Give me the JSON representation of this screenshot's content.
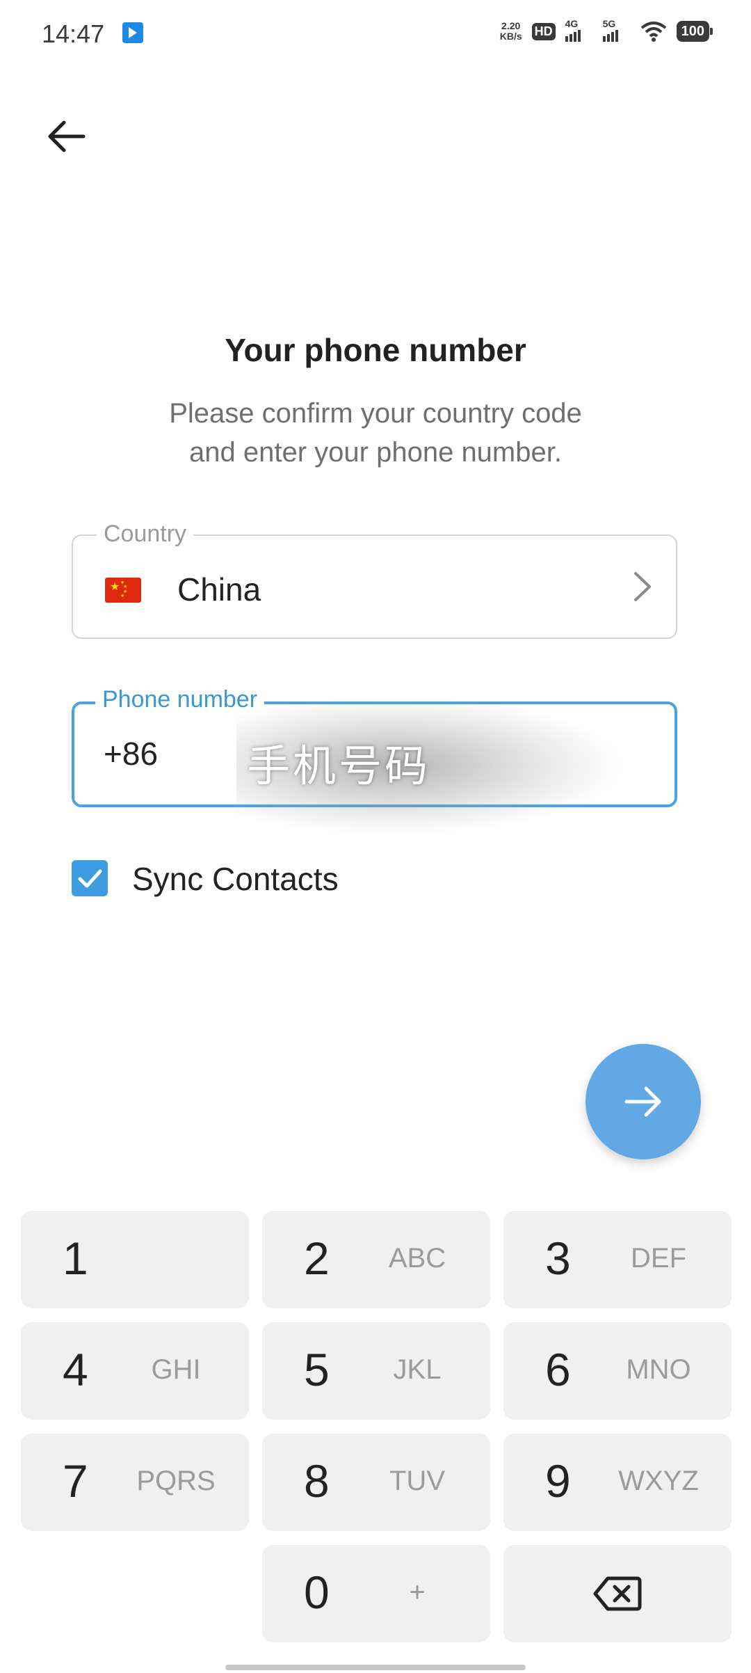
{
  "status_bar": {
    "time": "14:47",
    "net_speed_value": "2.20",
    "net_speed_unit": "KB/s",
    "hd_label": "HD",
    "signal1_label": "4G",
    "signal2_label": "5G",
    "battery": "100"
  },
  "header": {
    "title": "Your phone number",
    "subtitle_line1": "Please confirm your country code",
    "subtitle_line2": "and enter your phone number."
  },
  "country_field": {
    "label": "Country",
    "value": "China",
    "flag_icon": "china-flag-icon"
  },
  "phone_field": {
    "label": "Phone number",
    "prefix": "+86",
    "value": "",
    "redaction_text": "手机号码"
  },
  "sync_contacts": {
    "label": "Sync Contacts",
    "checked": true
  },
  "colors": {
    "accent": "#3d9be0",
    "fab": "#62a8e5",
    "key_bg": "#f0f0f0"
  },
  "keypad": {
    "keys": [
      {
        "num": "1",
        "letters": ""
      },
      {
        "num": "2",
        "letters": "ABC"
      },
      {
        "num": "3",
        "letters": "DEF"
      },
      {
        "num": "4",
        "letters": "GHI"
      },
      {
        "num": "5",
        "letters": "JKL"
      },
      {
        "num": "6",
        "letters": "MNO"
      },
      {
        "num": "7",
        "letters": "PQRS"
      },
      {
        "num": "8",
        "letters": "TUV"
      },
      {
        "num": "9",
        "letters": "WXYZ"
      },
      {
        "num": "0",
        "letters": "+"
      }
    ]
  }
}
